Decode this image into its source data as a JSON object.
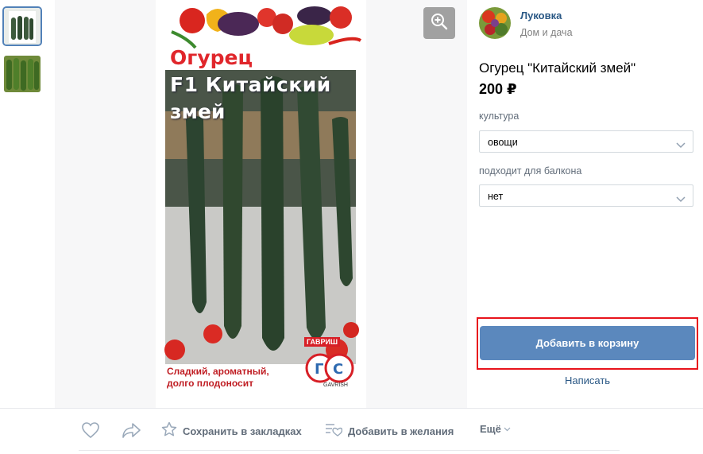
{
  "gallery": {
    "thumbnails": [
      "thumbnail-packet",
      "thumbnail-cucumbers"
    ]
  },
  "packet": {
    "title_line1": "Огурец",
    "title_line2": "F1 Китайский",
    "title_line3": "змей",
    "description_line1": "Сладкий, ароматный,",
    "description_line2": "долго плодоносит",
    "brand_ru": "ГАВРИШ",
    "brand_logo": "ГС",
    "brand_en": "GAVRISH"
  },
  "shop": {
    "name": "Луковка",
    "category": "Дом и дача"
  },
  "product": {
    "title": "Огурец \"Китайский змей\"",
    "price": "200 ₽",
    "properties": [
      {
        "label": "культура",
        "value": "овощи"
      },
      {
        "label": "подходит для балкона",
        "value": "нет"
      }
    ]
  },
  "buttons": {
    "add_to_cart": "Добавить в корзину",
    "write": "Написать"
  },
  "actions": {
    "like_icon": "heart-icon",
    "share_icon": "share-arrow-icon",
    "bookmark": "Сохранить в закладках",
    "wishlist": "Добавить в желания",
    "more": "Ещё"
  },
  "colors": {
    "accent": "#5b88bd",
    "link": "#2a5885",
    "highlight": "#e8141c"
  }
}
